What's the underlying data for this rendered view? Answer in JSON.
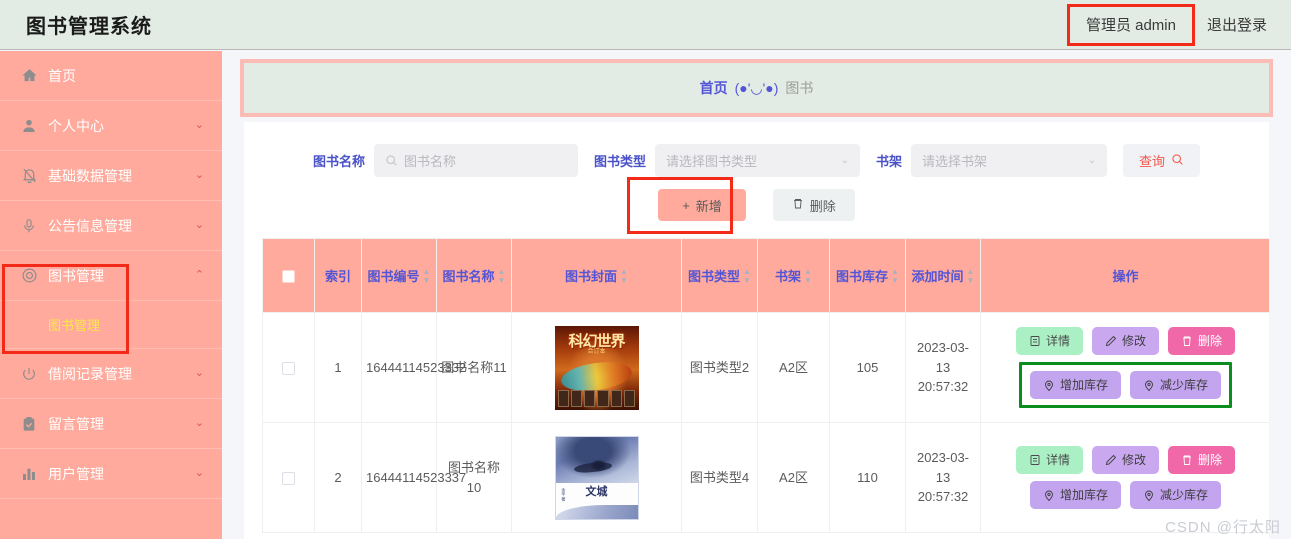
{
  "header": {
    "brand": "图书管理系统",
    "user": "管理员 admin",
    "logout": "退出登录"
  },
  "sidebar": {
    "items": [
      {
        "label": "首页",
        "icon": "home-icon",
        "arrow": ""
      },
      {
        "label": "个人中心",
        "icon": "user-icon",
        "arrow": "⌄"
      },
      {
        "label": "基础数据管理",
        "icon": "bell-off-icon",
        "arrow": "⌄"
      },
      {
        "label": "公告信息管理",
        "icon": "microphone-icon",
        "arrow": "⌄"
      },
      {
        "label": "图书管理",
        "icon": "target-icon",
        "arrow": "⌃"
      },
      {
        "label": "借阅记录管理",
        "icon": "power-icon",
        "arrow": "⌄"
      },
      {
        "label": "留言管理",
        "icon": "clipboard-check-icon",
        "arrow": "⌄"
      },
      {
        "label": "用户管理",
        "icon": "bar-chart-icon",
        "arrow": "⌄"
      }
    ],
    "submenu": {
      "label": "图书管理"
    }
  },
  "breadcrumb": {
    "home": "首页",
    "separator": "(●'◡'●)",
    "current": "图书"
  },
  "search": {
    "name_label": "图书名称",
    "name_placeholder": "图书名称",
    "type_label": "图书类型",
    "type_placeholder": "请选择图书类型",
    "shelf_label": "书架",
    "shelf_placeholder": "请选择书架",
    "query_button": "查询"
  },
  "actions": {
    "add": "新增",
    "add_prefix": "+",
    "delete": "删除"
  },
  "table": {
    "headers": [
      {
        "label": "",
        "sortable": false
      },
      {
        "label": "索引",
        "sortable": false
      },
      {
        "label": "图书编号",
        "sortable": true
      },
      {
        "label": "图书名称",
        "sortable": true
      },
      {
        "label": "图书封面",
        "sortable": true
      },
      {
        "label": "图书类型",
        "sortable": true
      },
      {
        "label": "书架",
        "sortable": true
      },
      {
        "label": "图书库存",
        "sortable": true
      },
      {
        "label": "添加时间",
        "sortable": true
      },
      {
        "label": "操作",
        "sortable": false
      }
    ],
    "rows": [
      {
        "index": "1",
        "book_no": "16444114523332",
        "book_name": "图书名称11",
        "cover": "科幻世界",
        "cover_sub": "合订本",
        "book_type": "图书类型2",
        "shelf": "A2区",
        "stock": "105",
        "added_time": "2023-03-13 20:57:32",
        "ops": {
          "detail": "详情",
          "edit": "修改",
          "delete": "删除",
          "add_stock": "增加库存",
          "reduce_stock": "减少库存"
        }
      },
      {
        "index": "2",
        "book_no": "16444114523337",
        "book_name": "图书名称10",
        "cover": "文城",
        "cover_sub": "余华 著",
        "book_type": "图书类型4",
        "shelf": "A2区",
        "stock": "110",
        "added_time": "2023-03-13 20:57:32",
        "ops": {
          "detail": "详情",
          "edit": "修改",
          "delete": "删除",
          "add_stock": "增加库存",
          "reduce_stock": "减少库存"
        }
      }
    ]
  },
  "watermark": "CSDN @行太阳",
  "colors": {
    "sidebar": "#ffaa9c",
    "header": "#e2ece5",
    "accent_blue": "#5355d6",
    "highlight_red": "#f32a17",
    "highlight_green": "#0a8f1e"
  }
}
